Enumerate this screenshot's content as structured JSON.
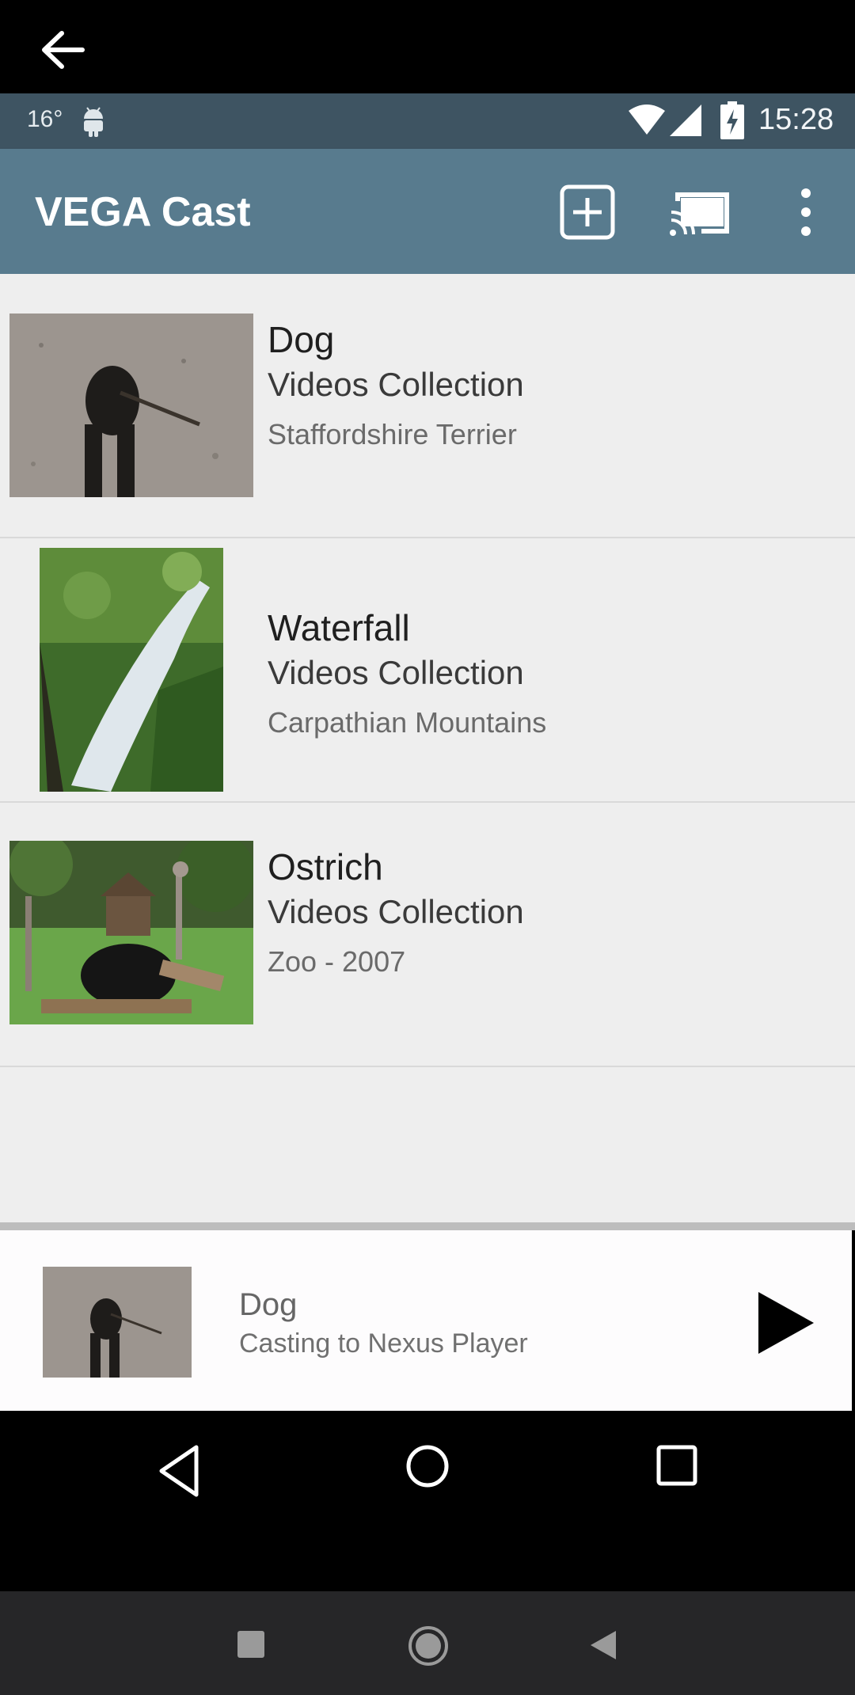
{
  "status_bar": {
    "temperature": "16°",
    "time": "15:28"
  },
  "app_bar": {
    "title": "VEGA Cast"
  },
  "videos": [
    {
      "title": "Dog",
      "collection": "Videos Collection",
      "subtitle": "Staffordshire Terrier"
    },
    {
      "title": "Waterfall",
      "collection": "Videos Collection",
      "subtitle": "Carpathian Mountains"
    },
    {
      "title": "Ostrich",
      "collection": "Videos Collection",
      "subtitle": "Zoo - 2007"
    }
  ],
  "mini_player": {
    "title": "Dog",
    "subtitle": "Casting to Nexus Player"
  },
  "colors": {
    "app_bar": "#587b8e",
    "status_bar": "#3e5462",
    "list_bg": "#eeeeee"
  }
}
